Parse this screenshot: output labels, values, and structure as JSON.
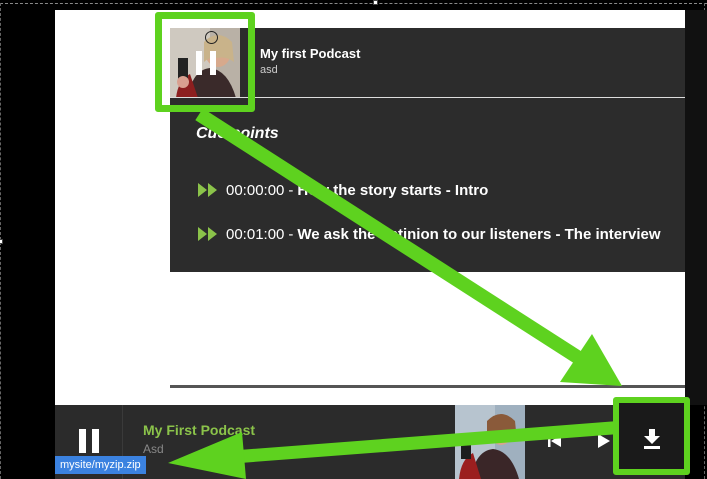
{
  "podcast_card": {
    "title": "My first Podcast",
    "subtitle": "asd",
    "cuepoints_heading": "Cue points",
    "cuepoints": [
      {
        "time": "00:00:00",
        "title": "How the story starts - Intro"
      },
      {
        "time": "00:01:00",
        "title": "We ask the optinion to our listeners - The interview"
      }
    ]
  },
  "player": {
    "title": "My First Podcast",
    "subtitle": "Asd"
  },
  "status_bar": {
    "url": "mysite/myzip.zip"
  },
  "colors": {
    "accent_green": "#5ed21f",
    "player_title_green": "#8bc34a",
    "card_bg": "#2c2c2c",
    "status_blue": "#3b82e0"
  },
  "icons": {
    "thumb_overlay": "pause-icon",
    "cue_marker": "fast-forward-icon",
    "player_main": "pause-icon",
    "player_prev": "skip-previous-icon",
    "player_next": "play-icon",
    "download": "download-icon"
  }
}
